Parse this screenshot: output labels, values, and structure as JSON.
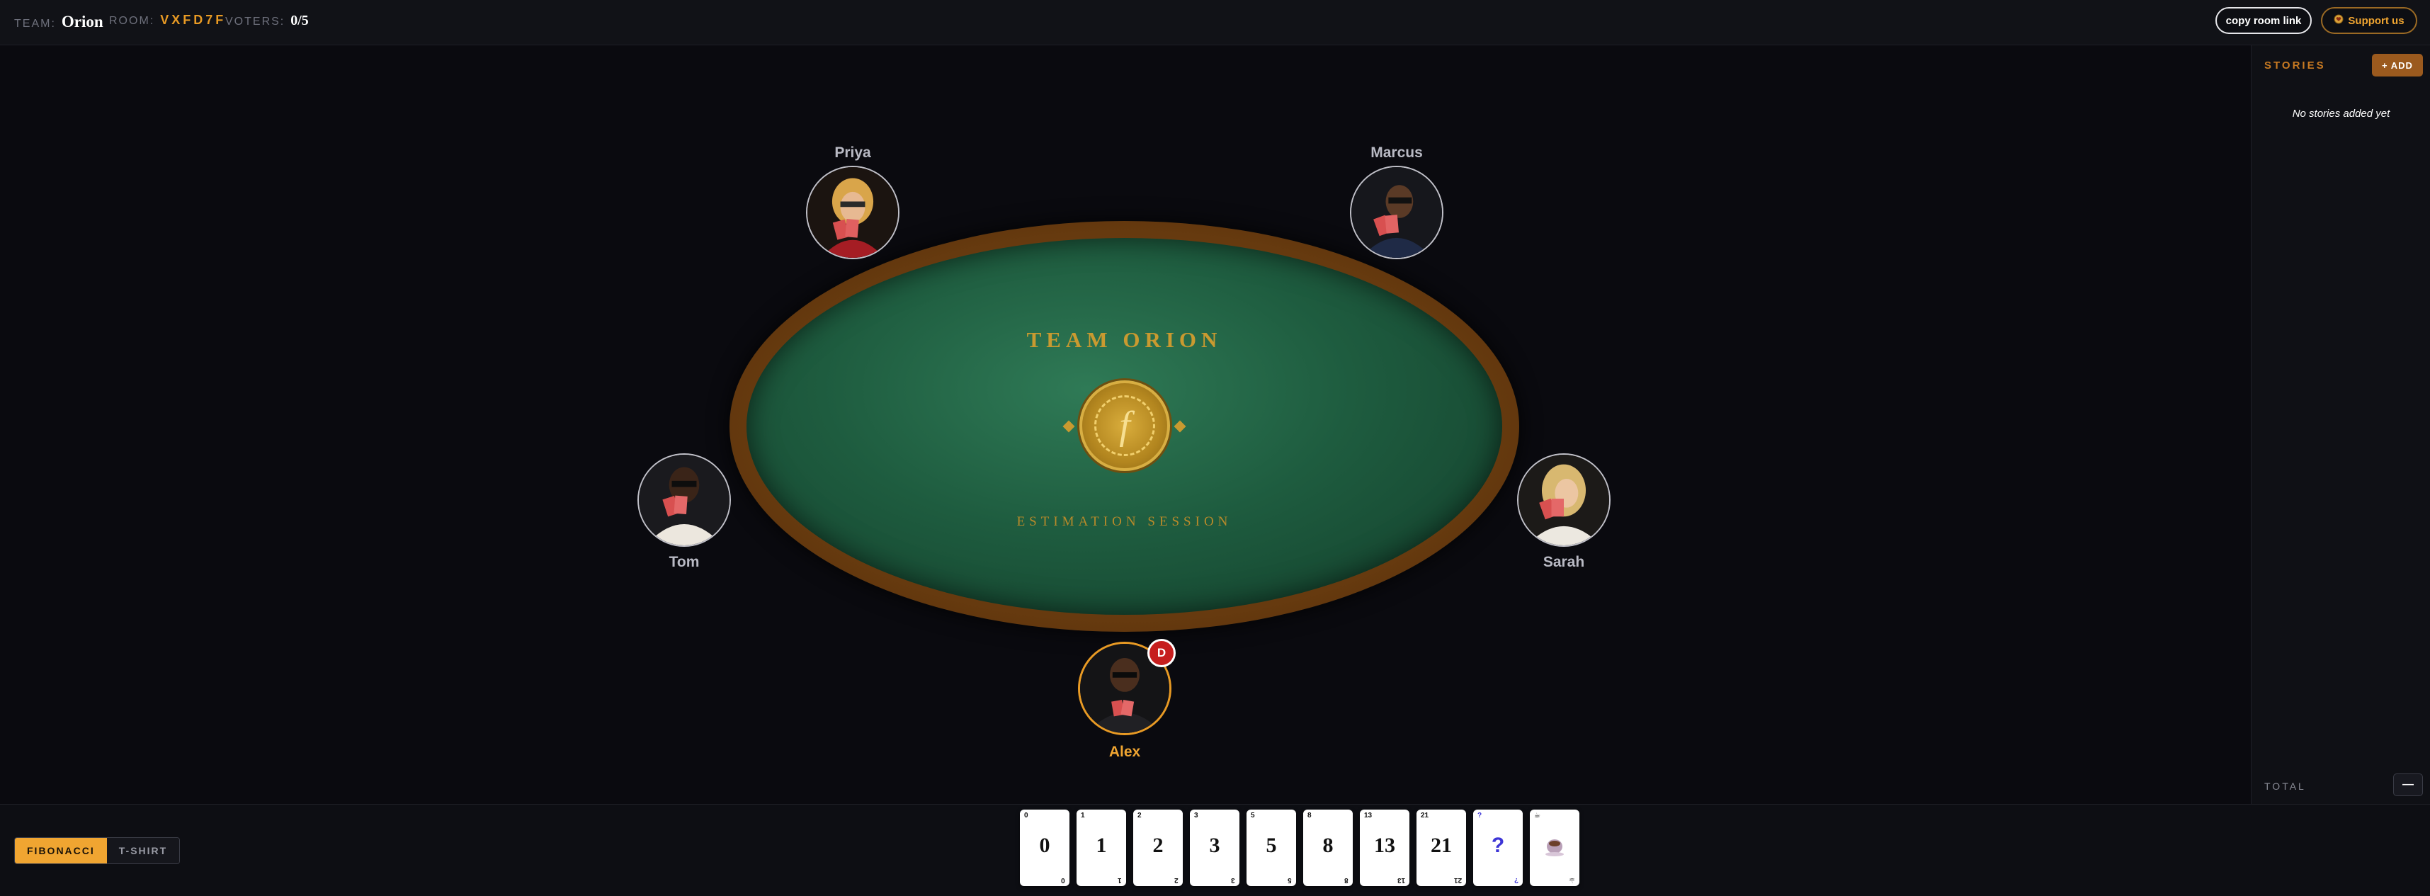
{
  "header": {
    "team_label": "TEAM:",
    "team_name": "Orion",
    "room_label": "ROOM:",
    "room_code": "VXFD7F",
    "voters_label": "VOTERS:",
    "voters_value": "0/5",
    "copy_button": "copy room link",
    "support_button": "Support us"
  },
  "table": {
    "title": "TEAM ORION",
    "subtitle": "ESTIMATION SESSION",
    "chip_glyph": "f"
  },
  "players": [
    {
      "name": "Priya",
      "active": false
    },
    {
      "name": "Marcus",
      "active": false
    },
    {
      "name": "Tom",
      "active": false
    },
    {
      "name": "Sarah",
      "active": false
    },
    {
      "name": "Alex",
      "active": true
    }
  ],
  "dealer_badge": "D",
  "sidebar": {
    "title": "STORIES",
    "add_button": "+ ADD",
    "empty_text": "No stories added yet",
    "total_label": "TOTAL",
    "total_value": "—"
  },
  "deck": {
    "options": [
      "FIBONACCI",
      "T-SHIRT"
    ],
    "selected": "FIBONACCI"
  },
  "cards": [
    "0",
    "1",
    "2",
    "3",
    "5",
    "8",
    "13",
    "21",
    "?",
    "coffee"
  ],
  "colors": {
    "accent": "#f0a531",
    "felt": "#1e5c3f",
    "rim": "#6b3d10",
    "gold": "#c99a30",
    "dealer": "#c61e1e"
  }
}
